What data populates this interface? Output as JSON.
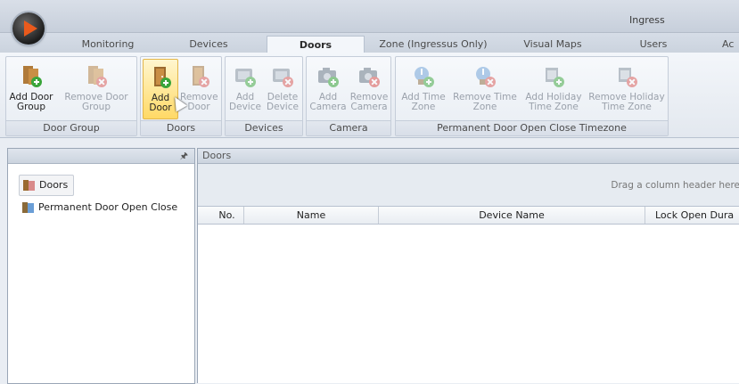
{
  "app": {
    "title": "Ingress"
  },
  "tabs": [
    {
      "label": "Monitoring"
    },
    {
      "label": "Devices"
    },
    {
      "label": "Doors",
      "active": true
    },
    {
      "label": "Zone (Ingressus Only)"
    },
    {
      "label": "Visual Maps"
    },
    {
      "label": "Users"
    },
    {
      "label": "Ac"
    }
  ],
  "ribbon": {
    "door_group": {
      "label": "Door Group",
      "add": "Add Door Group",
      "remove": "Remove Door Group"
    },
    "doors": {
      "label": "Doors",
      "add": "Add Door",
      "remove": "Remove Door"
    },
    "devices": {
      "label": "Devices",
      "add": "Add Device",
      "delete": "Delete Device"
    },
    "camera": {
      "label": "Camera",
      "add": "Add Camera",
      "remove": "Remove Camera"
    },
    "timezone": {
      "label": "Permanent Door Open Close Timezone",
      "add_time": "Add Time Zone",
      "remove_time": "Remove Time Zone",
      "add_holiday": "Add Holiday Time Zone",
      "remove_holiday": "Remove Holiday Time Zone"
    }
  },
  "left_panel": {
    "pin_icon": "pin-icon",
    "items": [
      {
        "label": "Doors",
        "icon": "door-icon",
        "selected": true
      },
      {
        "label": "Permanent Door Open Close",
        "icon": "door-timezone-icon"
      }
    ]
  },
  "right_panel": {
    "title": "Doors",
    "group_hint": "Drag a column header here",
    "columns": [
      "No.",
      "Name",
      "Device Name",
      "Lock Open Dura"
    ]
  },
  "colors": {
    "accent_orange": "#ea5a1c",
    "hover_yellow": "#ffd966",
    "add_green": "#3aa53a",
    "remove_red": "#d9534f"
  }
}
